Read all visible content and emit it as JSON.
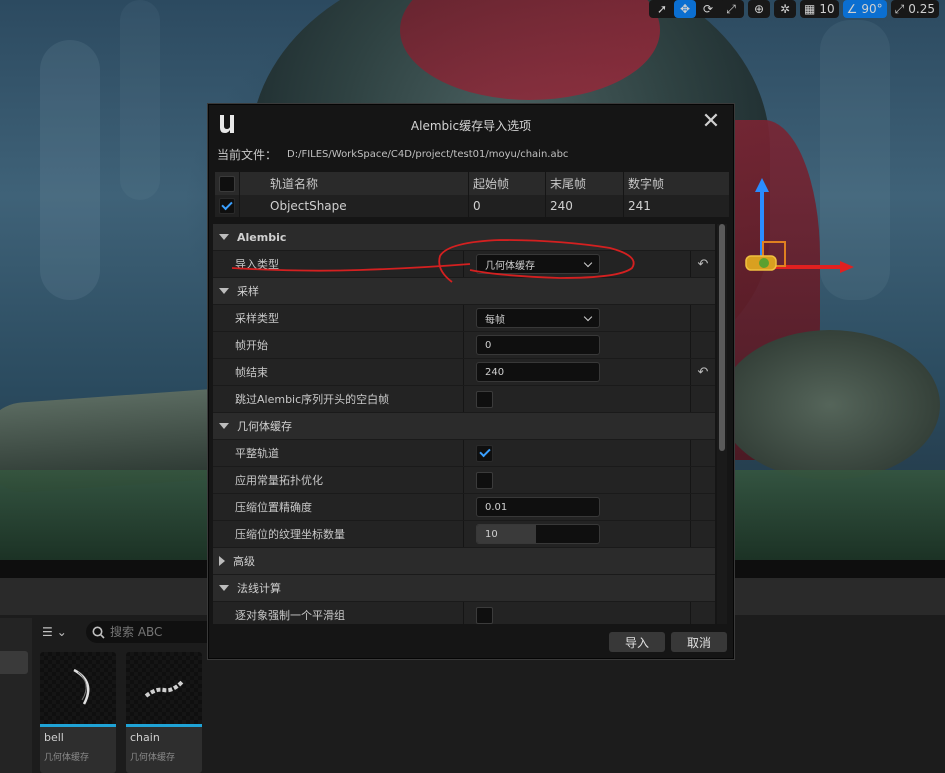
{
  "viewport_toolbar": {
    "grid_snap_value": "10",
    "angle_snap_value": "90°",
    "scale_snap_value": "0.25"
  },
  "dialog": {
    "title": "Alembic缓存导入选项",
    "current_file_label": "当前文件：",
    "current_file_path": "D:/FILES/WorkSpace/C4D/project/test01/moyu/chain.abc",
    "tracks": {
      "columns": [
        "轨道名称",
        "起始帧",
        "末尾帧",
        "数字帧"
      ],
      "rows": [
        {
          "checked": true,
          "name": "ObjectShape",
          "start": "0",
          "end": "240",
          "count": "241"
        }
      ]
    },
    "sections": {
      "alembic": {
        "title": "Alembic",
        "import_type_label": "导入类型",
        "import_type_value": "几何体缓存"
      },
      "sampling": {
        "title": "采样",
        "sample_type_label": "采样类型",
        "sample_type_value": "每帧",
        "frame_start_label": "帧开始",
        "frame_start_value": "0",
        "frame_end_label": "帧结束",
        "frame_end_value": "240",
        "skip_empty_label": "跳过Alembic序列开头的空白帧",
        "skip_empty_checked": false
      },
      "geometry_cache": {
        "title": "几何体缓存",
        "flatten_tracks_label": "平整轨道",
        "flatten_tracks_checked": true,
        "const_topology_label": "应用常量拓扑优化",
        "const_topology_checked": false,
        "pos_precision_label": "压缩位置精确度",
        "pos_precision_value": "0.01",
        "uv_bits_label": "压缩位的纹理坐标数量",
        "uv_bits_value": "10",
        "uv_bits_fill_fraction": 0.48
      },
      "advanced": {
        "title": "高级"
      },
      "normal_calc": {
        "title": "法线计算",
        "force_smoothing_label": "逐对象强制一个平滑组",
        "force_smoothing_checked": false
      }
    },
    "buttons": {
      "import": "导入",
      "cancel": "取消"
    }
  },
  "content_browser": {
    "search_placeholder": "搜索 ABC",
    "assets": [
      {
        "name": "bell",
        "type": "几何体缓存"
      },
      {
        "name": "chain",
        "type": "几何体缓存"
      }
    ]
  },
  "colors": {
    "accent_blue": "#0b6fd1",
    "check_blue": "#3aa0ff",
    "annotation_red": "#d42020",
    "asset_bar": "#1fa3d6"
  }
}
